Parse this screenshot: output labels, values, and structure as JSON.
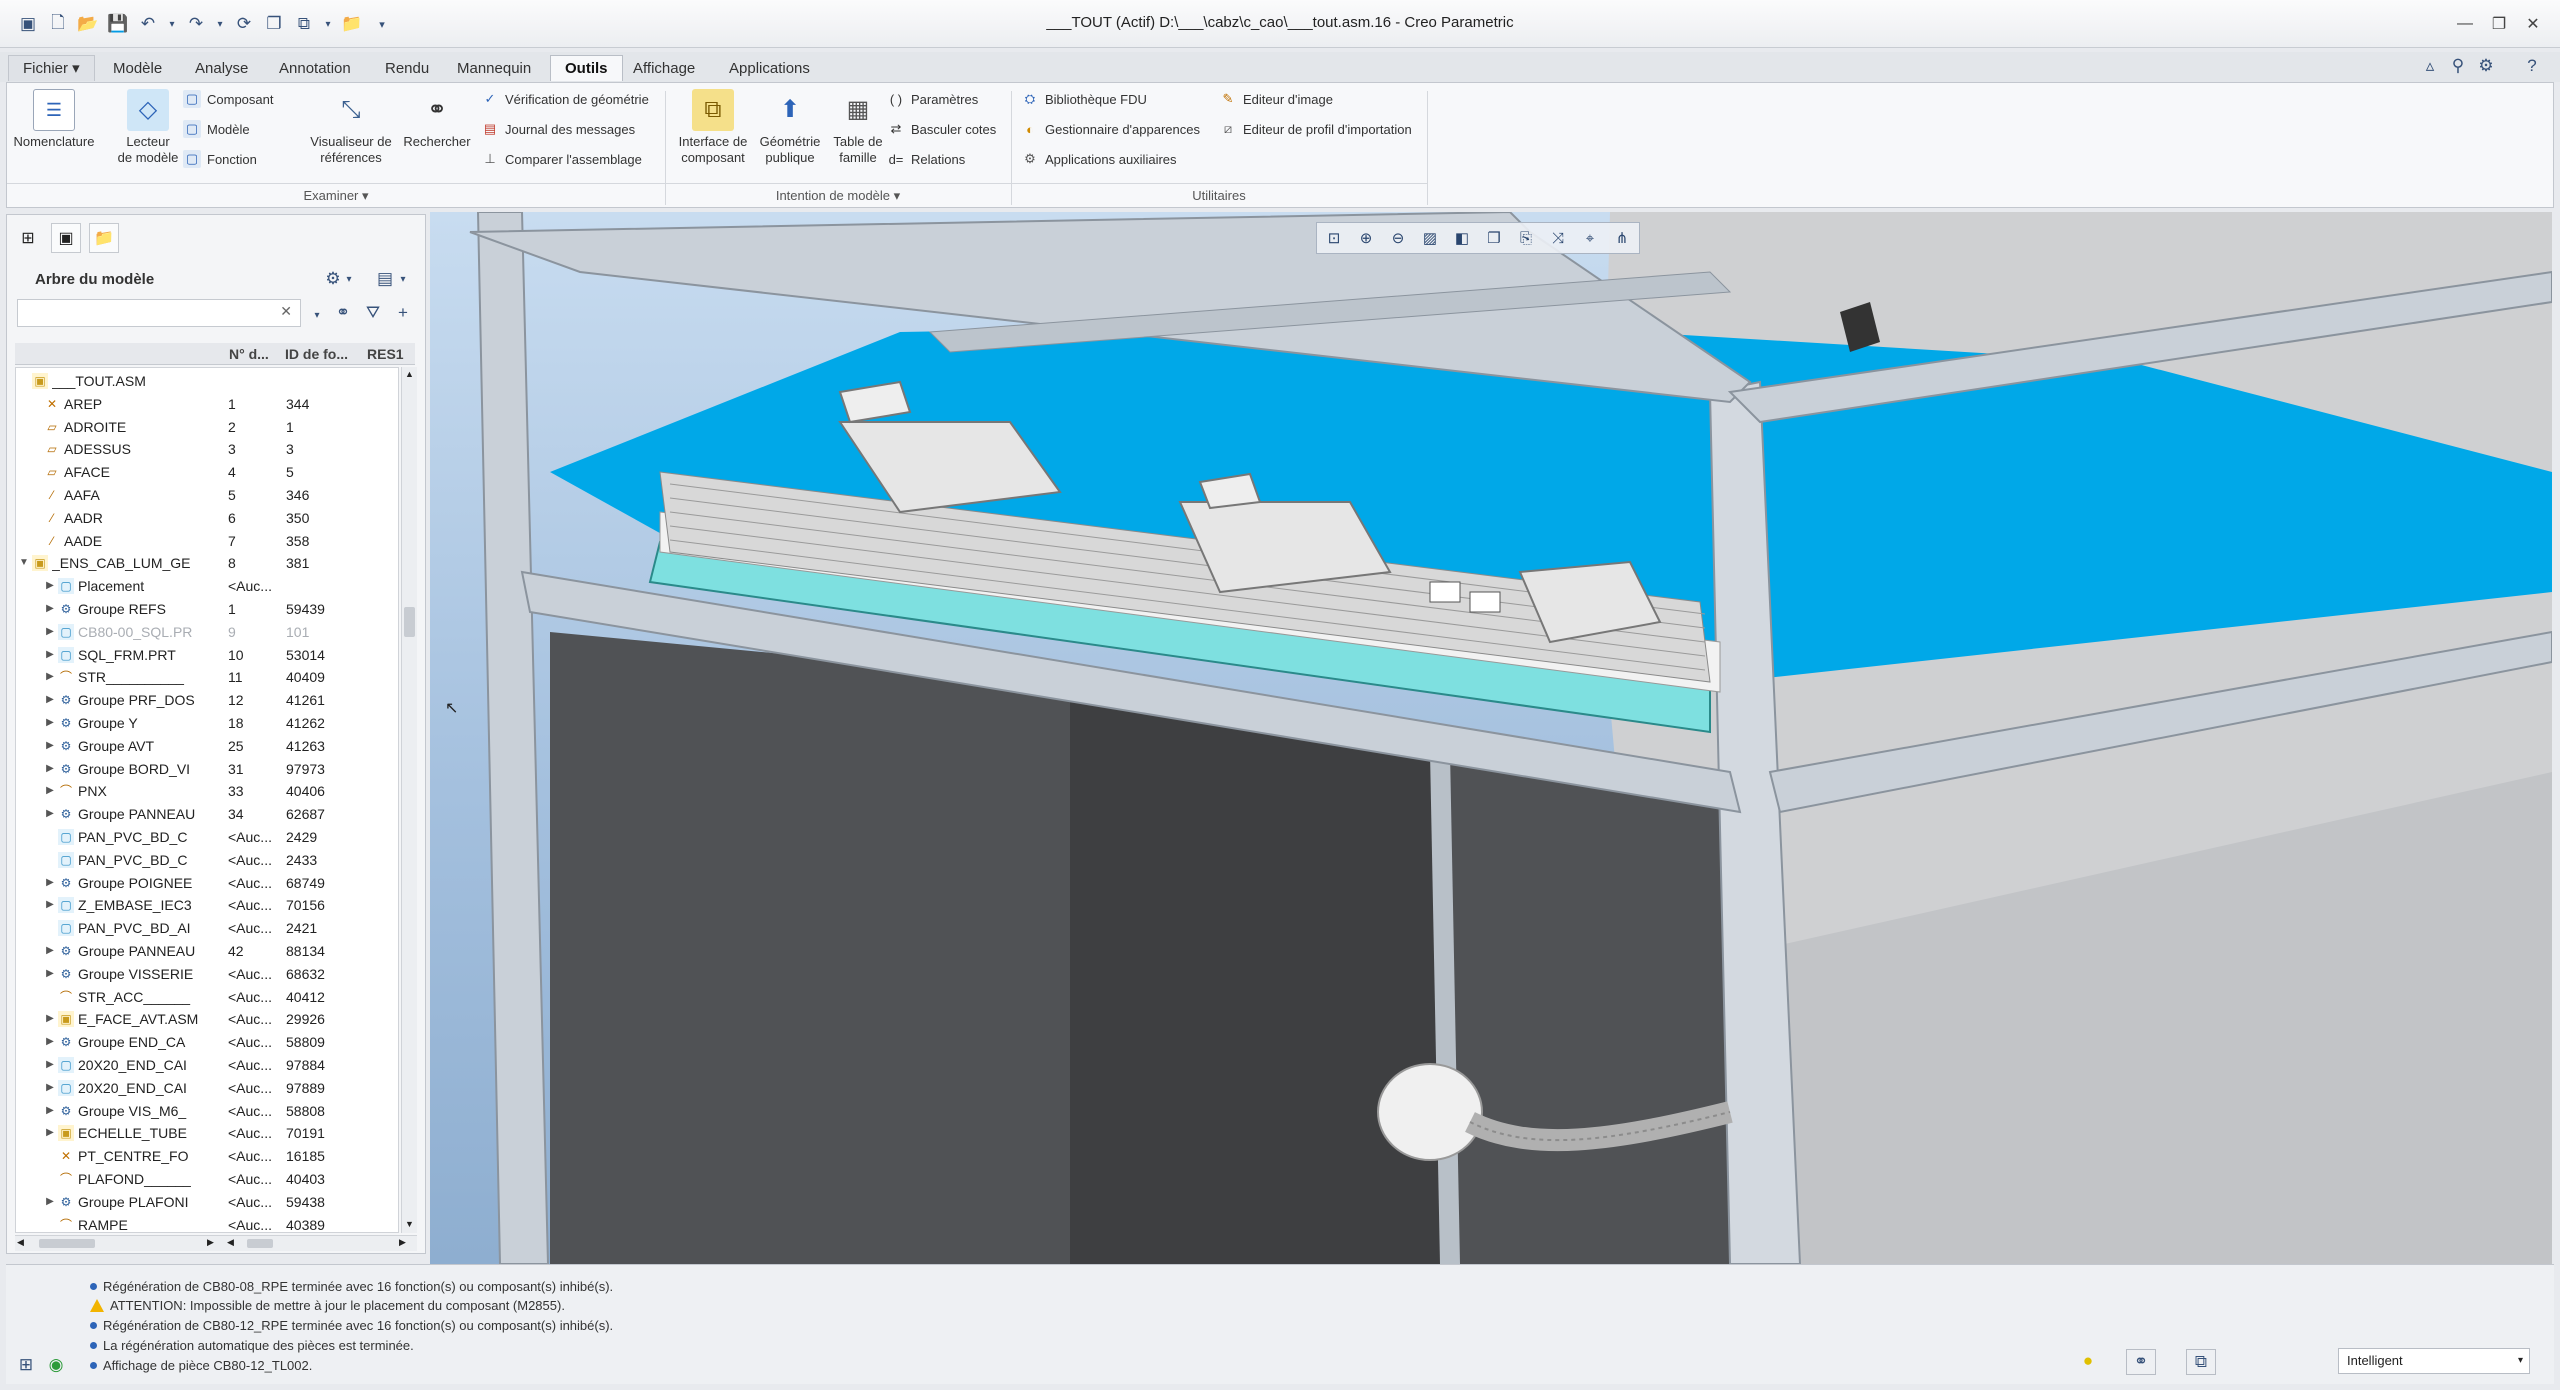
{
  "window": {
    "title": "___TOUT (Actif) D:\\___\\cabz\\c_cao\\___tout.asm.16 - Creo Parametric"
  },
  "menu_tabs": [
    {
      "label": "Fichier ▾"
    },
    {
      "label": "Modèle"
    },
    {
      "label": "Analyse"
    },
    {
      "label": "Annotation"
    },
    {
      "label": "Rendu"
    },
    {
      "label": "Mannequin"
    },
    {
      "label": "Outils"
    },
    {
      "label": "Affichage"
    },
    {
      "label": "Applications"
    }
  ],
  "ribbon": {
    "nomenclature": "Nomenclature",
    "lecteur_l1": "Lecteur",
    "lecteur_l2": "de modèle",
    "composant": "Composant",
    "modele": "Modèle",
    "fonction": "Fonction",
    "visualiseur_l1": "Visualiseur de",
    "visualiseur_l2": "références",
    "rechercher": "Rechercher",
    "verif_geometrie": "Vérification de géométrie",
    "journal_messages": "Journal des messages",
    "comparer_assemblage": "Comparer l'assemblage",
    "interface_l1": "Interface de",
    "interface_l2": "composant",
    "geometrie_l1": "Géométrie",
    "geometrie_l2": "publique",
    "table_l1": "Table de",
    "table_l2": "famille",
    "parametres": "Paramètres",
    "basculer_cotes": "Basculer cotes",
    "relations": "Relations",
    "bibliotheque_fdu": "Bibliothèque FDU",
    "gestionnaire_apparences": "Gestionnaire d'apparences",
    "applications_auxiliaires": "Applications auxiliaires",
    "editeur_image": "Editeur d'image",
    "editeur_profil": "Editeur de profil d'importation",
    "group_examiner": "Examiner ▾",
    "group_intention": "Intention de modèle ▾",
    "group_utilitaires": "Utilitaires"
  },
  "model_tree": {
    "title": "Arbre du modèle",
    "columns": [
      "N° d...",
      "ID de fo...",
      "RES1"
    ],
    "rows": [
      {
        "name": "___TOUT.ASM",
        "num": "",
        "id": "",
        "level": 0,
        "toggle": "",
        "icon": "assembly",
        "dim": false
      },
      {
        "name": "AREP",
        "num": "1",
        "id": "344",
        "level": 1,
        "toggle": "",
        "icon": "csys",
        "dim": false
      },
      {
        "name": "ADROITE",
        "num": "2",
        "id": "1",
        "level": 1,
        "toggle": "",
        "icon": "plane",
        "dim": false
      },
      {
        "name": "ADESSUS",
        "num": "3",
        "id": "3",
        "level": 1,
        "toggle": "",
        "icon": "plane",
        "dim": false
      },
      {
        "name": "AFACE",
        "num": "4",
        "id": "5",
        "level": 1,
        "toggle": "",
        "icon": "plane",
        "dim": false
      },
      {
        "name": "AAFA",
        "num": "5",
        "id": "346",
        "level": 1,
        "toggle": "",
        "icon": "axis",
        "dim": false
      },
      {
        "name": "AADR",
        "num": "6",
        "id": "350",
        "level": 1,
        "toggle": "",
        "icon": "axis",
        "dim": false
      },
      {
        "name": "AADE",
        "num": "7",
        "id": "358",
        "level": 1,
        "toggle": "",
        "icon": "axis",
        "dim": false
      },
      {
        "name": "_ENS_CAB_LUM_GE",
        "num": "8",
        "id": "381",
        "level": 0,
        "toggle": "▼",
        "icon": "assembly",
        "dim": false
      },
      {
        "name": "Placement",
        "num": "<Auc...",
        "id": "",
        "level": 2,
        "toggle": "▶",
        "icon": "part",
        "dim": false
      },
      {
        "name": "Groupe REFS",
        "num": "1",
        "id": "59439",
        "level": 2,
        "toggle": "▶",
        "icon": "group",
        "dim": false
      },
      {
        "name": "CB80-00_SQL.PR",
        "num": "9",
        "id": "101",
        "level": 2,
        "toggle": "▶",
        "icon": "part",
        "dim": true
      },
      {
        "name": "SQL_FRM.PRT",
        "num": "10",
        "id": "53014",
        "level": 2,
        "toggle": "▶",
        "icon": "part",
        "dim": false
      },
      {
        "name": "STR__________",
        "num": "11",
        "id": "40409",
        "level": 2,
        "toggle": "▶",
        "icon": "sketch",
        "dim": false
      },
      {
        "name": "Groupe PRF_DOS",
        "num": "12",
        "id": "41261",
        "level": 2,
        "toggle": "▶",
        "icon": "group",
        "dim": false
      },
      {
        "name": "Groupe Y",
        "num": "18",
        "id": "41262",
        "level": 2,
        "toggle": "▶",
        "icon": "group",
        "dim": false
      },
      {
        "name": "Groupe AVT",
        "num": "25",
        "id": "41263",
        "level": 2,
        "toggle": "▶",
        "icon": "group",
        "dim": false
      },
      {
        "name": "Groupe BORD_VI",
        "num": "31",
        "id": "97973",
        "level": 2,
        "toggle": "▶",
        "icon": "group",
        "dim": false
      },
      {
        "name": "PNX",
        "num": "33",
        "id": "40406",
        "level": 2,
        "toggle": "▶",
        "icon": "sketch",
        "dim": false
      },
      {
        "name": "Groupe PANNEAU",
        "num": "34",
        "id": "62687",
        "level": 2,
        "toggle": "▶",
        "icon": "group",
        "dim": false
      },
      {
        "name": "PAN_PVC_BD_C",
        "num": "<Auc...",
        "id": "2429",
        "level": 2,
        "toggle": "",
        "icon": "part",
        "dim": false
      },
      {
        "name": "PAN_PVC_BD_C",
        "num": "<Auc...",
        "id": "2433",
        "level": 2,
        "toggle": "",
        "icon": "part",
        "dim": false
      },
      {
        "name": "Groupe POIGNEE",
        "num": "<Auc...",
        "id": "68749",
        "level": 2,
        "toggle": "▶",
        "icon": "group",
        "dim": false
      },
      {
        "name": "Z_EMBASE_IEC3",
        "num": "<Auc...",
        "id": "70156",
        "level": 2,
        "toggle": "▶",
        "icon": "part",
        "dim": false
      },
      {
        "name": "PAN_PVC_BD_AI",
        "num": "<Auc...",
        "id": "2421",
        "level": 2,
        "toggle": "",
        "icon": "part",
        "dim": false
      },
      {
        "name": "Groupe PANNEAU",
        "num": "42",
        "id": "88134",
        "level": 2,
        "toggle": "▶",
        "icon": "group",
        "dim": false
      },
      {
        "name": "Groupe VISSERIE",
        "num": "<Auc...",
        "id": "68632",
        "level": 2,
        "toggle": "▶",
        "icon": "group",
        "dim": false
      },
      {
        "name": "STR_ACC______",
        "num": "<Auc...",
        "id": "40412",
        "level": 2,
        "toggle": "",
        "icon": "sketch",
        "dim": false
      },
      {
        "name": "E_FACE_AVT.ASM",
        "num": "<Auc...",
        "id": "29926",
        "level": 2,
        "toggle": "▶",
        "icon": "assembly",
        "dim": false
      },
      {
        "name": "Groupe END_CA",
        "num": "<Auc...",
        "id": "58809",
        "level": 2,
        "toggle": "▶",
        "icon": "group",
        "dim": false
      },
      {
        "name": "20X20_END_CAI",
        "num": "<Auc...",
        "id": "97884",
        "level": 2,
        "toggle": "▶",
        "icon": "part",
        "dim": false
      },
      {
        "name": "20X20_END_CAI",
        "num": "<Auc...",
        "id": "97889",
        "level": 2,
        "toggle": "▶",
        "icon": "part",
        "dim": false
      },
      {
        "name": "Groupe VIS_M6_",
        "num": "<Auc...",
        "id": "58808",
        "level": 2,
        "toggle": "▶",
        "icon": "group",
        "dim": false
      },
      {
        "name": "ECHELLE_TUBE",
        "num": "<Auc...",
        "id": "70191",
        "level": 2,
        "toggle": "▶",
        "icon": "assembly",
        "dim": false
      },
      {
        "name": "PT_CENTRE_FO",
        "num": "<Auc...",
        "id": "16185",
        "level": 2,
        "toggle": "",
        "icon": "csys",
        "dim": false
      },
      {
        "name": "PLAFOND______",
        "num": "<Auc...",
        "id": "40403",
        "level": 2,
        "toggle": "",
        "icon": "sketch",
        "dim": false
      },
      {
        "name": "Groupe PLAFONI",
        "num": "<Auc...",
        "id": "59438",
        "level": 2,
        "toggle": "▶",
        "icon": "group",
        "dim": false
      },
      {
        "name": "RAMPE________",
        "num": "<Auc...",
        "id": "40389",
        "level": 2,
        "toggle": "",
        "icon": "sketch",
        "dim": false
      }
    ]
  },
  "messages": [
    {
      "type": "info",
      "text": "Régénération de CB80-08_RPE terminée avec 16 fonction(s) ou composant(s) inhibé(s)."
    },
    {
      "type": "warning",
      "text": "ATTENTION: Impossible de mettre à jour le placement du composant (M2855)."
    },
    {
      "type": "info",
      "text": "Régénération de CB80-12_RPE terminée avec 16 fonction(s) ou composant(s) inhibé(s)."
    },
    {
      "type": "info",
      "text": "La régénération automatique des pièces est terminée."
    },
    {
      "type": "info",
      "text": "Affichage de pièce CB80-12_TL002."
    }
  ],
  "status": {
    "selection_filter": "Intelligent"
  },
  "colors": {
    "accent_blue": "#00a8e8",
    "ribbon_bg": "#f7f8fa",
    "viewport_bg": "#b6cde6"
  }
}
